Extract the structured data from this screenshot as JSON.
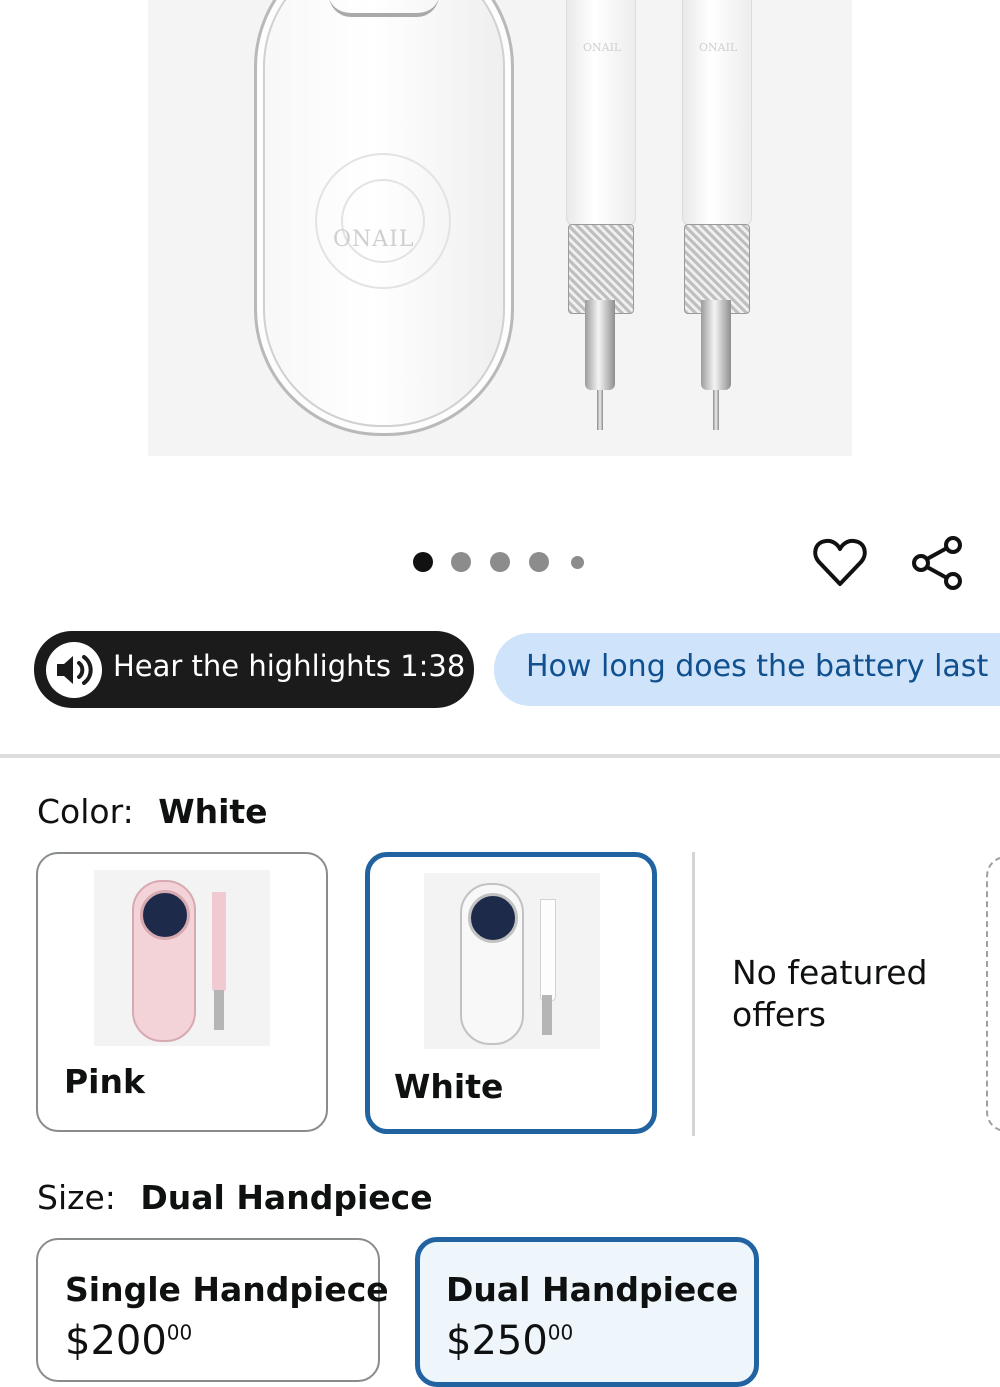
{
  "product": {
    "brand_mark": "ONAIL",
    "image_dots": {
      "count": 5,
      "active_index": 0
    }
  },
  "actions": {
    "wishlist_icon": "heart-icon",
    "share_icon": "share-icon"
  },
  "pills": {
    "hear_label": "Hear the highlights 1:38",
    "hear_icon": "speaker-icon",
    "question_label": "How long does the battery last p"
  },
  "color": {
    "label": "Color:",
    "selected": "White",
    "options": [
      {
        "name": "Pink",
        "tint": "#f3d3d8"
      },
      {
        "name": "White",
        "tint": "#f4f4f4"
      }
    ],
    "no_offers_text": "No featured offers"
  },
  "size": {
    "label": "Size:",
    "selected": "Dual Handpiece",
    "options": [
      {
        "name": "Single Handpiece",
        "price": "$200",
        "cents": "00"
      },
      {
        "name": "Dual Handpiece",
        "price": "$250",
        "cents": "00"
      }
    ]
  },
  "colors": {
    "accent": "#2162a1",
    "pill_dark": "#1b1b1b",
    "pill_blue": "#cfe3fb",
    "pill_blue_text": "#10508f"
  }
}
